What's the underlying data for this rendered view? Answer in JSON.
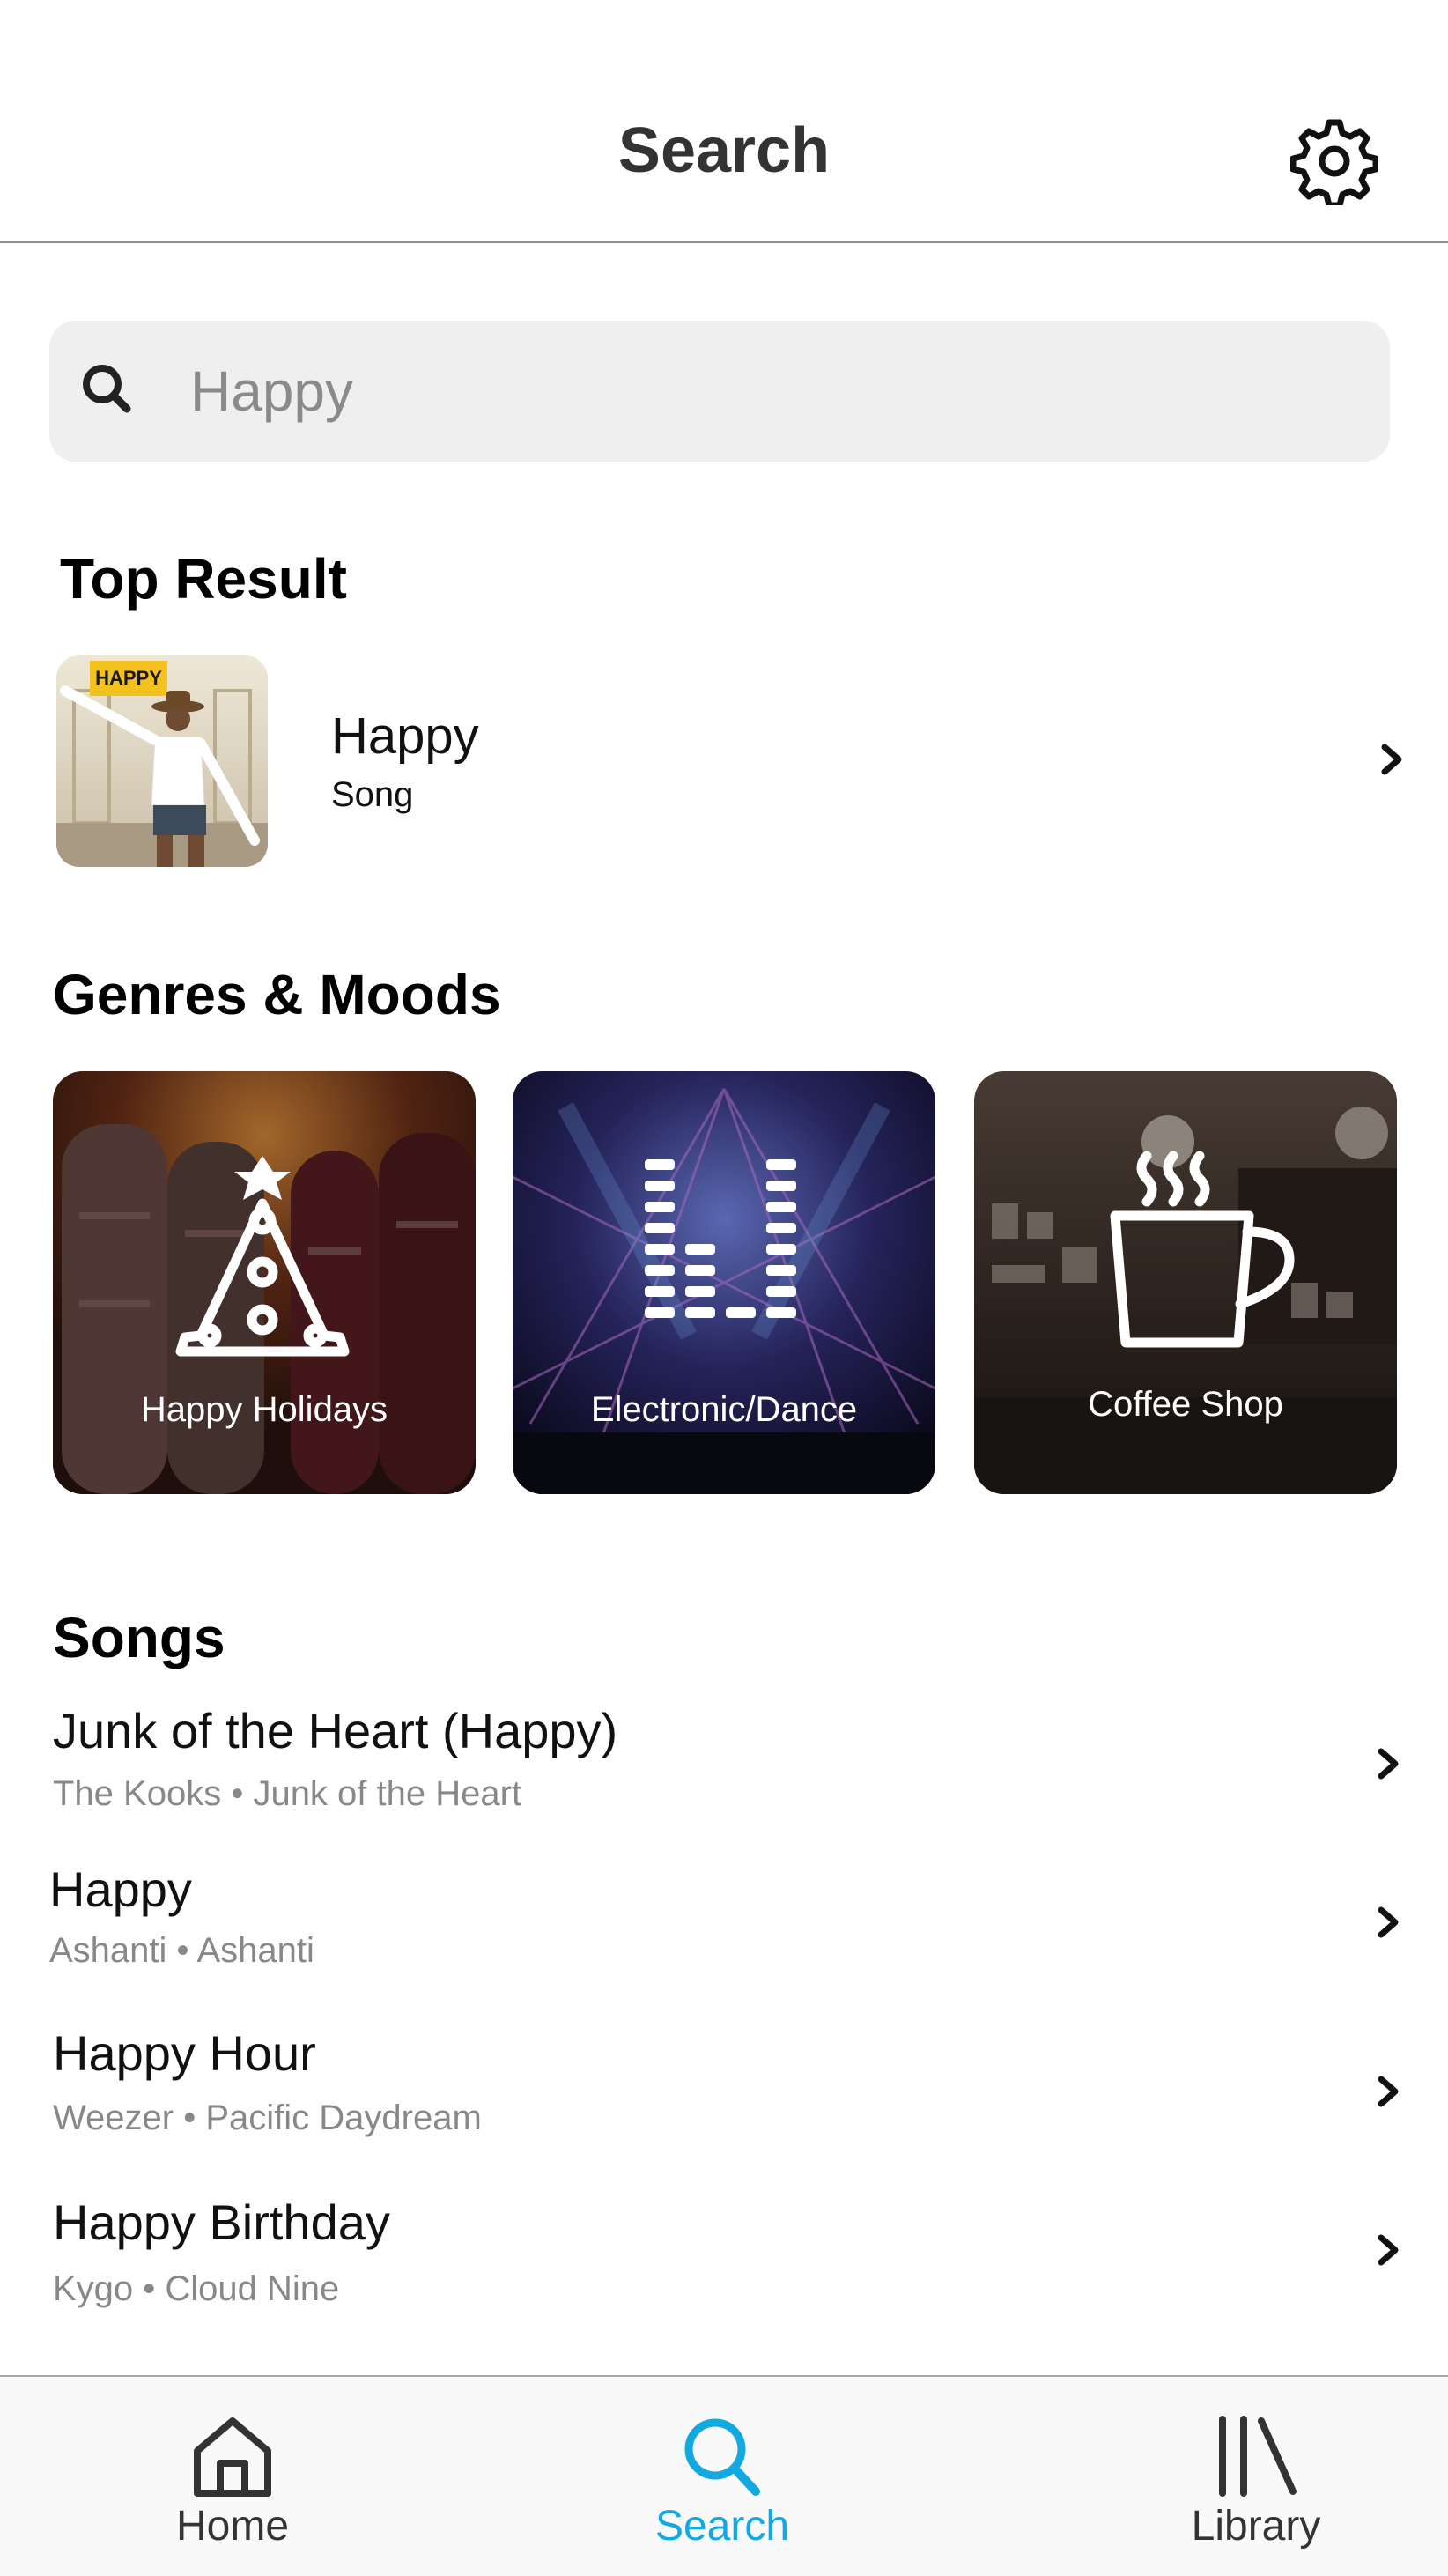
{
  "header": {
    "title": "Search",
    "settings_icon": "gear-icon"
  },
  "search": {
    "icon": "search-icon",
    "placeholder": "Happy",
    "value": "Happy"
  },
  "top_result": {
    "section_title": "Top Result",
    "item": {
      "title": "Happy",
      "subtitle": "Song",
      "artwork_text": "HAPPY"
    }
  },
  "genres": {
    "section_title": "Genres & Moods",
    "items": [
      {
        "label": "Happy Holidays",
        "icon": "christmas-tree-icon"
      },
      {
        "label": "Electronic/Dance",
        "icon": "equalizer-icon"
      },
      {
        "label": "Coffee Shop",
        "icon": "coffee-cup-icon"
      }
    ]
  },
  "songs": {
    "section_title": "Songs",
    "items": [
      {
        "title": "Junk of the Heart (Happy)",
        "meta": "The Kooks • Junk of the Heart"
      },
      {
        "title": "Happy",
        "meta": "Ashanti • Ashanti"
      },
      {
        "title": "Happy Hour",
        "meta": "Weezer • Pacific Daydream"
      },
      {
        "title": "Happy Birthday",
        "meta": "Kygo • Cloud Nine"
      }
    ]
  },
  "tabbar": {
    "active": "Search",
    "tabs": [
      {
        "label": "Home",
        "icon": "home-icon"
      },
      {
        "label": "Search",
        "icon": "search-icon"
      },
      {
        "label": "Library",
        "icon": "library-icon"
      }
    ]
  },
  "colors": {
    "accent": "#12a8e0",
    "search_bg": "#efeff0",
    "secondary_text": "#888888"
  }
}
